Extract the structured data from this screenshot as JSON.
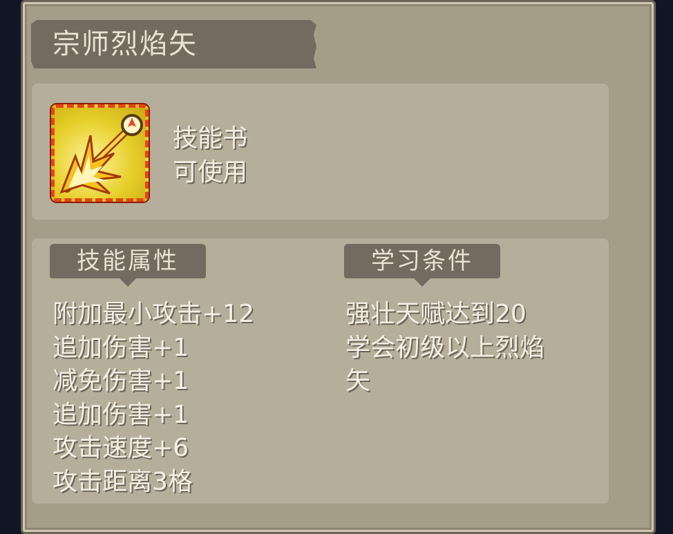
{
  "title": "宗师烈焰矢",
  "item": {
    "icon": "flame-arrow-skill-icon",
    "type": "技能书",
    "status": "可使用"
  },
  "attributes": {
    "header": "技能属性",
    "items": [
      "附加最小攻击+12",
      "追加伤害+1",
      "减免伤害+1",
      "追加伤害+1",
      "攻击速度+6",
      "攻击距离3格"
    ]
  },
  "requirements": {
    "header": "学习条件",
    "lines": [
      "强壮天赋达到20",
      "学会初级以上烈焰",
      "矢"
    ]
  },
  "colors": {
    "frame": "#a59d88",
    "panel": "#b5ae9b",
    "tab": "#736a60",
    "text": "#f3efe3",
    "icon_border": "#e8421b",
    "icon_fill": "#e6cf2a"
  }
}
